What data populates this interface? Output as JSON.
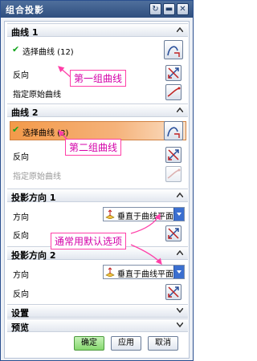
{
  "window": {
    "title": "组合投影"
  },
  "title_buttons": {
    "reset": "↻",
    "min": "▬",
    "close": "✕"
  },
  "sections": {
    "curve1": {
      "title": "曲线 1",
      "select_label": "选择曲线 (12)",
      "reverse_label": "反向",
      "specify_label": "指定原始曲线"
    },
    "curve2": {
      "title": "曲线 2",
      "select_label": "选择曲线 (3)",
      "reverse_label": "反向",
      "specify_label": "指定原始曲线"
    },
    "proj1": {
      "title": "投影方向 1",
      "direction_label": "方向",
      "direction_value": "垂直于曲线平面",
      "reverse_label": "反向"
    },
    "proj2": {
      "title": "投影方向 2",
      "direction_label": "方向",
      "direction_value": "垂直于曲线平面",
      "reverse_label": "反向"
    },
    "settings": {
      "title": "设置"
    },
    "preview": {
      "title": "预览"
    }
  },
  "annotations": {
    "first_curve": "第一组曲线",
    "second_curve": "第二组曲线",
    "default_option": "通常用默认选项"
  },
  "footer": {
    "ok": "确定",
    "apply": "应用",
    "cancel": "取消"
  },
  "colors": {
    "accent_pink": "#ff3fa8",
    "selected_orange": "#f39a4a",
    "title_blue": "#2f4f7f"
  }
}
